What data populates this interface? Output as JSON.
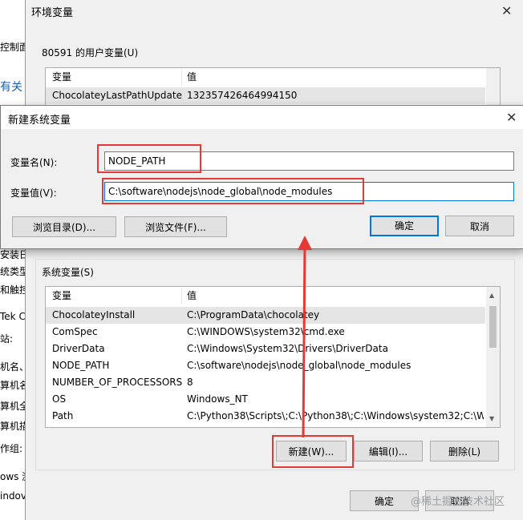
{
  "background_window": {
    "lines": [
      "控制面板",
      "有关",
      "安装日",
      "统类型",
      "和触控",
      "Tek C",
      "站:",
      "机名、域",
      "算机名",
      "算机全",
      "算机描",
      "作组:",
      "ows 激",
      "indov"
    ]
  },
  "env_window": {
    "title": "环境变量",
    "user_vars_label": "80591 的用户变量(U)",
    "user_vars_columns": [
      "变量",
      "值"
    ],
    "user_vars_rows": [
      {
        "name": "ChocolateyLastPathUpdate",
        "value": "132357426464994150"
      }
    ],
    "system_vars_label": "系统变量(S)",
    "system_vars_columns": [
      "变量",
      "值"
    ],
    "system_vars_rows": [
      {
        "name": "ChocolateyInstall",
        "value": "C:\\ProgramData\\chocolatey"
      },
      {
        "name": "ComSpec",
        "value": "C:\\WINDOWS\\system32\\cmd.exe"
      },
      {
        "name": "DriverData",
        "value": "C:\\Windows\\System32\\Drivers\\DriverData"
      },
      {
        "name": "NODE_PATH",
        "value": "C:\\software\\nodejs\\node_global\\node_modules"
      },
      {
        "name": "NUMBER_OF_PROCESSORS",
        "value": "8"
      },
      {
        "name": "OS",
        "value": "Windows_NT"
      },
      {
        "name": "Path",
        "value": "C:\\Python38\\Scripts\\;C:\\Python38\\;C:\\Windows\\system32;C:\\W..."
      }
    ],
    "new_button": "新建(W)...",
    "edit_button": "编辑(I)...",
    "delete_button": "删除(L)",
    "ok_button": "确定",
    "cancel_button": "取消"
  },
  "new_var_dialog": {
    "title": "新建系统变量",
    "name_label": "变量名(N):",
    "name_value": "NODE_PATH",
    "value_label": "变量值(V):",
    "value_value": "C:\\software\\nodejs\\node_global\\node_modules",
    "browse_dir_button": "浏览目录(D)...",
    "browse_file_button": "浏览文件(F)...",
    "ok_button": "确定",
    "cancel_button": "取消"
  },
  "watermark": "@稀土掘金技术社区",
  "colors": {
    "highlight_red": "#e53935",
    "focus_blue": "#0078d7"
  }
}
